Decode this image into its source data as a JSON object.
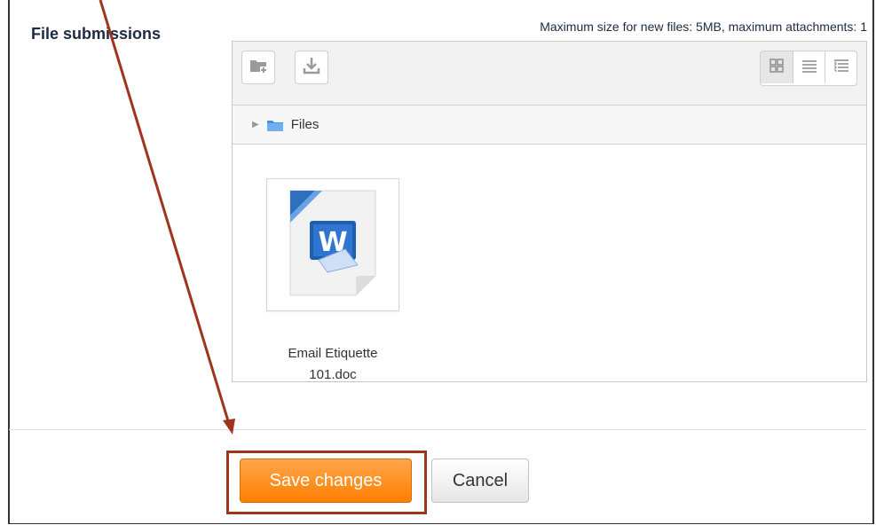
{
  "form": {
    "field_label": "File submissions",
    "max_size_text": "Maximum size for new files: 5MB, maximum attachments: 1"
  },
  "filepicker": {
    "toolbar": {
      "add_icon": "folder-add-icon",
      "download_icon": "download-icon",
      "view_modes": [
        "icons-view-icon",
        "list-view-icon",
        "tree-view-icon"
      ],
      "active_view": "icons-view-icon"
    },
    "path": {
      "label": "Files",
      "folder_color": "#4a90e2"
    },
    "files": [
      {
        "name": "Email Etiquette",
        "name_line2": "101.doc",
        "icon": "word-document-icon"
      }
    ]
  },
  "buttons": {
    "save_label": "Save changes",
    "cancel_label": "Cancel",
    "save_color": "#ff8c1a"
  },
  "annotation": {
    "color": "#a0331c"
  }
}
